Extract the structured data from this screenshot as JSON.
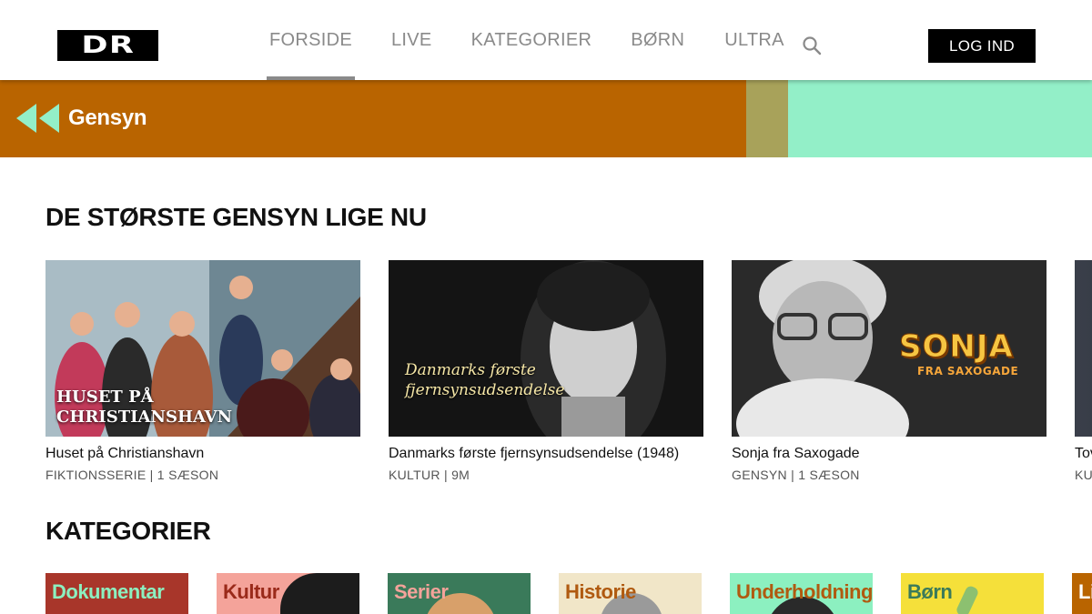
{
  "header": {
    "logo_text": "DR",
    "nav": [
      "FORSIDE",
      "LIVE",
      "KATEGORIER",
      "BØRN",
      "ULTRA"
    ],
    "active_nav": "FORSIDE",
    "search_icon": "search-icon",
    "login_label": "LOG IND"
  },
  "banner": {
    "icon": "rewind-icon",
    "title": "Gensyn",
    "colors": {
      "primary": "#b96400",
      "secondary": "#a8a25a",
      "accent": "#93efc8"
    }
  },
  "sections": {
    "top": {
      "title": "DE STØRSTE GENSYN LIGE NU",
      "cards": [
        {
          "title": "Huset på Christianshavn",
          "meta": "FIKTIONSSERIE | 1 SÆSON",
          "overlay": "HUSET PÅ\nCHRISTIANSHAVN"
        },
        {
          "title": "Danmarks første fjernsynsudsendelse (1948)",
          "meta": "KULTUR | 9M",
          "overlay": "Danmarks første\nfjernsynsudsendelse"
        },
        {
          "title": "Sonja fra Saxogade",
          "meta": "GENSYN | 1 SÆSON",
          "overlay_big": "SONJA",
          "overlay_small": "FRA SAXOGADE"
        },
        {
          "title": "Tov",
          "meta": "KU"
        }
      ]
    },
    "categories": {
      "title": "KATEGORIER",
      "items": [
        {
          "label": "Dokumentar",
          "bg": "#a8362a",
          "fg": "#8cf0c0"
        },
        {
          "label": "Kultur",
          "bg": "#f4a39a",
          "fg": "#9a2a1a"
        },
        {
          "label": "Serier",
          "bg": "#3a7a5a",
          "fg": "#f4a39a"
        },
        {
          "label": "Historie",
          "bg": "#f1e6c8",
          "fg": "#b05a10"
        },
        {
          "label": "Underholdning",
          "bg": "#8cf0c0",
          "fg": "#b05a10"
        },
        {
          "label": "Børn",
          "bg": "#f5e03a",
          "fg": "#3a7a5a"
        },
        {
          "label": "Li",
          "bg": "#b96400",
          "fg": "#ffffff"
        }
      ]
    }
  }
}
